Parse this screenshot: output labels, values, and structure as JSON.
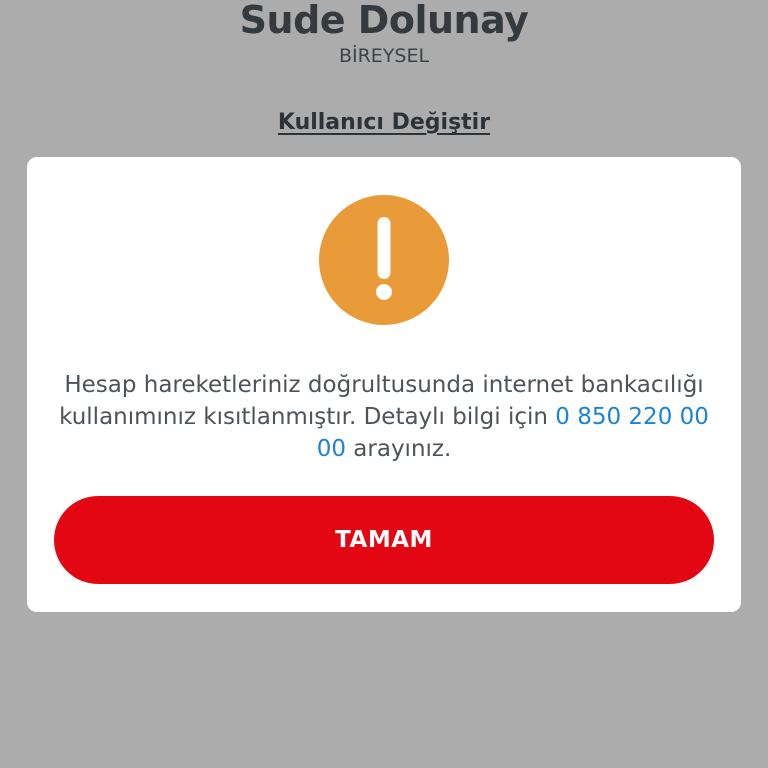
{
  "header": {
    "user_name": "Sude Dolunay",
    "account_type": "BİREYSEL",
    "switch_user_label": "Kullanıcı Değiştir"
  },
  "dialog": {
    "icon": "exclamation-warning-icon",
    "message_part1": "Hesap hareketleriniz doğrultusunda internet bankacılığı kullanımınız kısıtlanmıştır. Detaylı bilgi için ",
    "phone": "0 850 220 00 00",
    "message_part2": " arayınız.",
    "ok_label": "TAMAM"
  },
  "colors": {
    "background": "#acacac",
    "dialog_bg": "#ffffff",
    "warning_orange": "#e99a39",
    "button_red": "#e30613",
    "link_blue": "#1d83d4"
  }
}
